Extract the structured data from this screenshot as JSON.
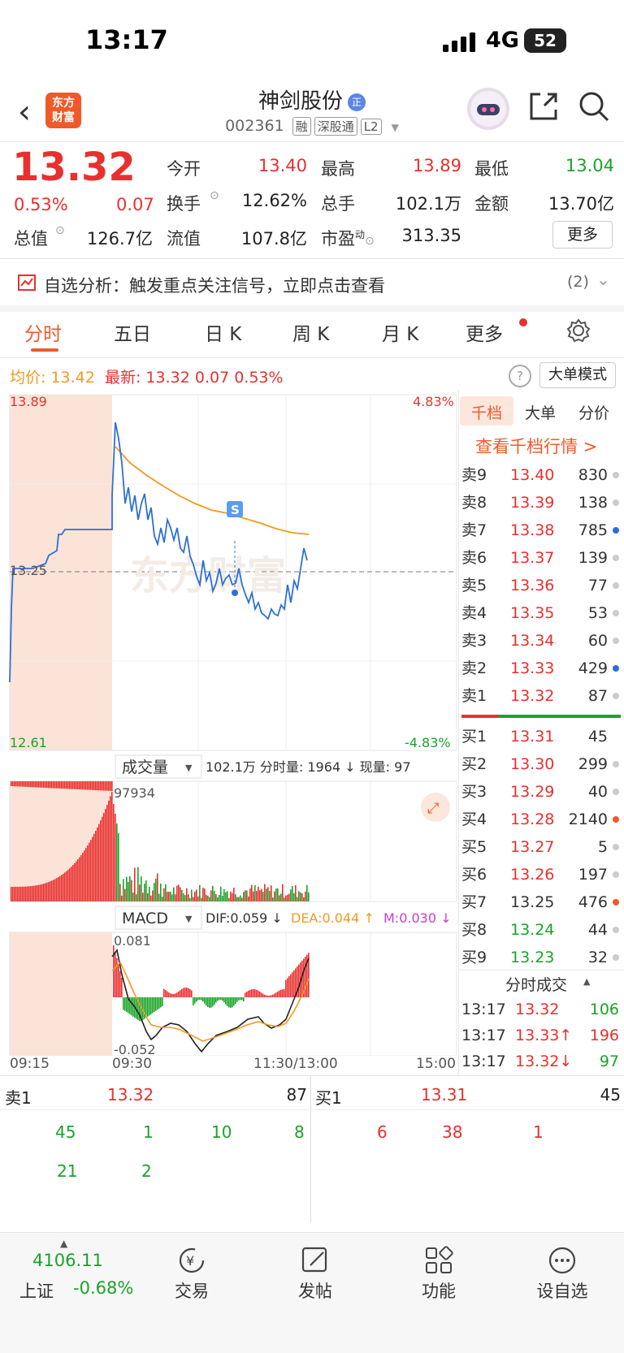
{
  "status_bar": {
    "time": "13:17",
    "network": "4G",
    "battery": "52"
  },
  "header": {
    "logo_line1": "东方",
    "logo_line2": "财富",
    "name": "神剑股份",
    "name_badge": "正",
    "code": "002361",
    "tags": [
      "融",
      "深股通",
      "L2"
    ]
  },
  "quote": {
    "price": "13.32",
    "pct": "0.53%",
    "change": "0.07",
    "open_label": "今开",
    "open": "13.40",
    "high_label": "最高",
    "high": "13.89",
    "low_label": "最低",
    "low": "13.04",
    "turnover_label": "换手",
    "turnover": "12.62%",
    "volume_label": "总手",
    "volume": "102.1万",
    "amount_label": "金额",
    "amount": "13.70亿",
    "mcap_label": "总值",
    "mcap": "126.7亿",
    "float_label": "流值",
    "float": "107.8亿",
    "pe_label": "市盈",
    "pe_sup": "动",
    "pe": "313.35",
    "more_label": "更多"
  },
  "analysis": {
    "text": "自选分析：触发重点关注信号，立即点击查看",
    "count": "(2)"
  },
  "tabs": [
    "分时",
    "五日",
    "日 K",
    "周 K",
    "月 K",
    "更多"
  ],
  "info_line": {
    "avg_label": "均价:",
    "avg": "13.42",
    "latest_label": "最新:",
    "latest": "13.32",
    "chg": "0.07",
    "pct": "0.53%",
    "big_order_label": "大单模式"
  },
  "price_chart": {
    "top_price": "13.89",
    "top_pct": "4.83%",
    "mid_price": "13.25",
    "bottom_price": "12.61",
    "bottom_pct": "-4.83%",
    "s_marker": "S",
    "watermark": "东方财富"
  },
  "volume_chart": {
    "selector": "成交量",
    "summary": "102.1万  分时量: 1964 ↓  现量: 97",
    "max": "97934"
  },
  "macd_chart": {
    "selector": "MACD",
    "dif": "DIF:0.059 ↓",
    "dea": "DEA:0.044 ↑",
    "m": "M:0.030 ↓",
    "top": "0.081",
    "bottom": "-0.052"
  },
  "time_axis": [
    "09:15",
    "09:30",
    "11:30/13:00",
    "15:00"
  ],
  "order_book": {
    "tabs": [
      "千档",
      "大单",
      "分价"
    ],
    "link": "查看千档行情 >",
    "asks": [
      {
        "label": "卖9",
        "price": "13.40",
        "vol": "830",
        "dot": "#cccccc"
      },
      {
        "label": "卖8",
        "price": "13.39",
        "vol": "138",
        "dot": "#cccccc"
      },
      {
        "label": "卖7",
        "price": "13.38",
        "vol": "785",
        "dot": "#2f6fd6"
      },
      {
        "label": "卖6",
        "price": "13.37",
        "vol": "139",
        "dot": "#cccccc"
      },
      {
        "label": "卖5",
        "price": "13.36",
        "vol": "77",
        "dot": "#cccccc"
      },
      {
        "label": "卖4",
        "price": "13.35",
        "vol": "53",
        "dot": "#cccccc"
      },
      {
        "label": "卖3",
        "price": "13.34",
        "vol": "60",
        "dot": "#cccccc"
      },
      {
        "label": "卖2",
        "price": "13.33",
        "vol": "429",
        "dot": "#2f6fd6"
      },
      {
        "label": "卖1",
        "price": "13.32",
        "vol": "87",
        "dot": "#cccccc"
      }
    ],
    "bids": [
      {
        "label": "买1",
        "price": "13.31",
        "vol": "45",
        "dot": "",
        "color": "#e8302e"
      },
      {
        "label": "买2",
        "price": "13.30",
        "vol": "299",
        "dot": "#cccccc",
        "color": "#e8302e"
      },
      {
        "label": "买3",
        "price": "13.29",
        "vol": "40",
        "dot": "#cccccc",
        "color": "#e8302e"
      },
      {
        "label": "买4",
        "price": "13.28",
        "vol": "2140",
        "dot": "#ef5a2a",
        "color": "#e8302e"
      },
      {
        "label": "买5",
        "price": "13.27",
        "vol": "5",
        "dot": "#cccccc",
        "color": "#e8302e"
      },
      {
        "label": "买6",
        "price": "13.26",
        "vol": "197",
        "dot": "#cccccc",
        "color": "#e8302e"
      },
      {
        "label": "买7",
        "price": "13.25",
        "vol": "476",
        "dot": "#ef5a2a",
        "color": "#333333"
      },
      {
        "label": "买8",
        "price": "13.24",
        "vol": "44",
        "dot": "#cccccc",
        "color": "#1aa329"
      },
      {
        "label": "买9",
        "price": "13.23",
        "vol": "32",
        "dot": "#cccccc",
        "color": "#1aa329"
      }
    ],
    "trades_title": "分时成交",
    "trades": [
      {
        "time": "13:17",
        "price": "13.32",
        "vol": "106",
        "price_color": "#e8302e",
        "vol_color": "#1aa329"
      },
      {
        "time": "13:17",
        "price": "13.33↑",
        "vol": "196",
        "price_color": "#e8302e",
        "vol_color": "#e8302e"
      },
      {
        "time": "13:17",
        "price": "13.32↓",
        "vol": "97",
        "price_color": "#e8302e",
        "vol_color": "#1aa329"
      }
    ]
  },
  "queue": {
    "sell_label": "卖1",
    "sell_price": "13.32",
    "sell_vol": "87",
    "buy_label": "买1",
    "buy_price": "13.31",
    "buy_vol": "45",
    "sell_orders_row1": [
      "45",
      "1",
      "10",
      "8"
    ],
    "sell_orders_row2": [
      "21",
      "2"
    ],
    "buy_orders_row1": [
      "6",
      "38",
      "1"
    ]
  },
  "bottom_nav": {
    "index_value": "4106.11",
    "index_name": "上证",
    "index_pct": "-0.68%",
    "items": [
      "交易",
      "发帖",
      "功能",
      "设自选"
    ]
  },
  "colors": {
    "up": "#e8302e",
    "down": "#1aa329",
    "accent": "#ef5a2a",
    "price_line": "#2f6fd6",
    "avg_line": "#f29a1d",
    "premarket_bg": "#fbe3d8"
  }
}
